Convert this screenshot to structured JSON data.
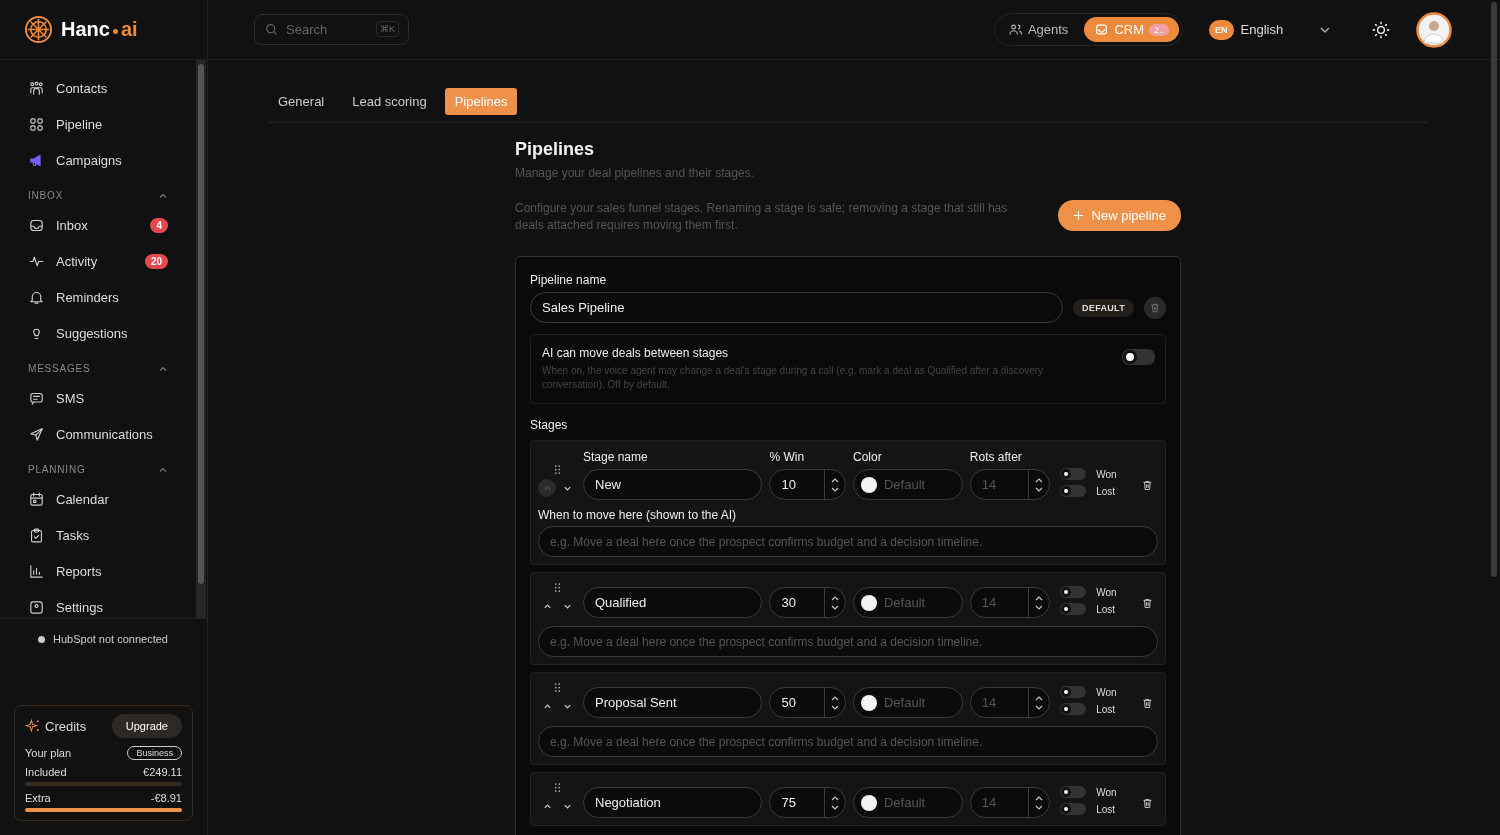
{
  "brand": {
    "name": "Hanc",
    "suffix": "ai"
  },
  "search": {
    "placeholder": "Search",
    "shortcut": "⌘K"
  },
  "top_switch": [
    {
      "label": "Agents",
      "selected": false
    },
    {
      "label": "CRM",
      "selected": true,
      "badge": "2.."
    }
  ],
  "language": {
    "code": "EN",
    "label": "English"
  },
  "sidebar": {
    "sections": [
      {
        "items": [
          {
            "label": "Contacts"
          },
          {
            "label": "Pipeline"
          },
          {
            "label": "Campaigns"
          }
        ]
      },
      {
        "title": "INBOX",
        "expanded": true,
        "items": [
          {
            "label": "Inbox",
            "badge": "4"
          },
          {
            "label": "Activity",
            "badge": "20"
          },
          {
            "label": "Reminders"
          },
          {
            "label": "Suggestions"
          }
        ]
      },
      {
        "title": "MESSAGES",
        "expanded": true,
        "items": [
          {
            "label": "SMS"
          },
          {
            "label": "Communications"
          }
        ]
      },
      {
        "title": "PLANNING",
        "expanded": true,
        "items": [
          {
            "label": "Calendar"
          },
          {
            "label": "Tasks"
          },
          {
            "label": "Reports"
          },
          {
            "label": "Settings"
          }
        ]
      }
    ],
    "integration": "HubSpot not connected",
    "credits": {
      "title": "Credits",
      "upgrade": "Upgrade",
      "plan_label": "Your plan",
      "plan": "Business",
      "rows": [
        {
          "label": "Included",
          "value": "€249.11"
        },
        {
          "label": "Extra",
          "value": "-€8.91",
          "level": 1
        }
      ]
    }
  },
  "tabs": [
    {
      "label": "General",
      "selected": false
    },
    {
      "label": "Lead scoring",
      "selected": false
    },
    {
      "label": "Pipelines",
      "selected": true
    }
  ],
  "page": {
    "title": "Pipelines",
    "subtitle": "Manage your deal pipelines and their stages.",
    "description": "Configure your sales funnel stages. Renaming a stage is safe; removing a stage that still has deals attached requires moving them first.",
    "new_button": "New pipeline"
  },
  "pipeline": {
    "name_label": "Pipeline name",
    "name": "Sales Pipeline",
    "badge": "DEFAULT",
    "ai_setting": {
      "title": "AI can move deals between stages",
      "description": "When on, the voice agent may change a deal's stage during a call (e.g. mark a deal as Qualified after a discovery conversation). Off by default.",
      "on": false
    },
    "stages_label": "Stages",
    "stages": [
      {
        "headers": [
          "Stage name",
          "% Win",
          "Color",
          "Rots after"
        ],
        "name": "New",
        "win": "10",
        "color_label": "Default",
        "rots": "14",
        "won_label": "Won",
        "won": false,
        "lost_label": "Lost",
        "lost": false,
        "up_disabled": true,
        "criteria_label": "When to move here (shown to the AI)",
        "criteria_placeholder": "e.g. Move a deal here once the prospect confirms budget and a decision timeline."
      },
      {
        "name": "Qualified",
        "win": "30",
        "color_label": "Default",
        "rots": "14",
        "won_label": "Won",
        "won": false,
        "lost_label": "Lost",
        "lost": false,
        "up_disabled": false,
        "criteria_placeholder": "e.g. Move a deal here once the prospect confirms budget and a decision timeline."
      },
      {
        "name": "Proposal Sent",
        "win": "50",
        "color_label": "Default",
        "rots": "14",
        "won_label": "Won",
        "won": false,
        "lost_label": "Lost",
        "lost": false,
        "up_disabled": false,
        "criteria_placeholder": "e.g. Move a deal here once the prospect confirms budget and a decision timeline."
      },
      {
        "name": "Negotiation",
        "win": "75",
        "color_label": "Default",
        "rots": "14",
        "won_label": "Won",
        "won": false,
        "lost_label": "Lost",
        "lost": false,
        "up_disabled": false
      }
    ]
  }
}
